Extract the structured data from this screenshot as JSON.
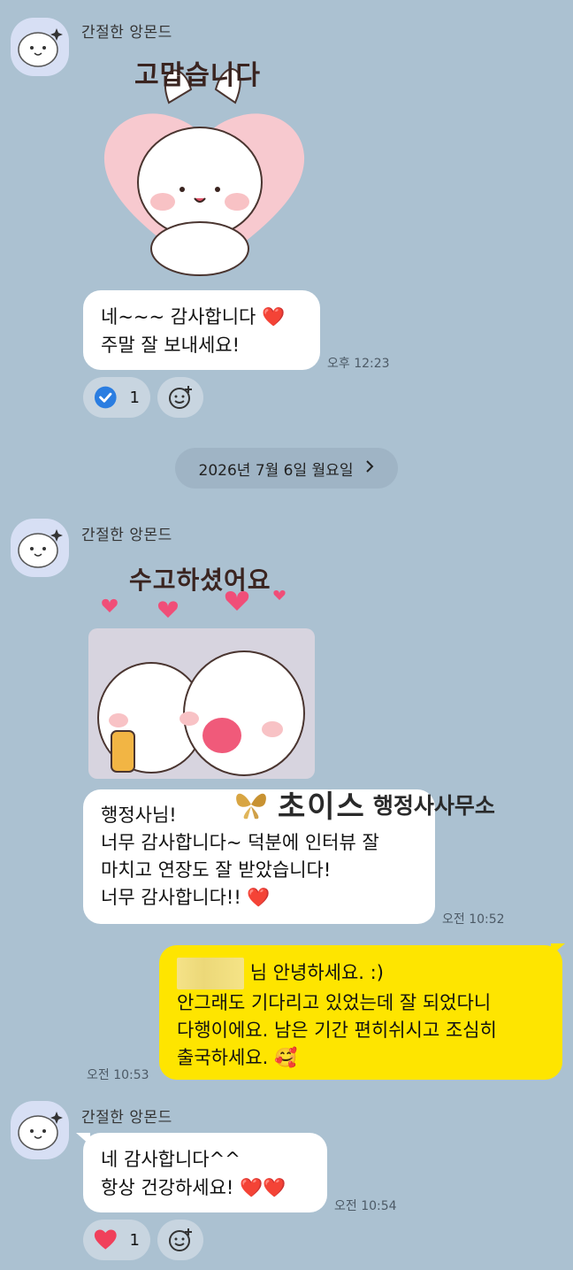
{
  "messages": [
    {
      "sender": "간절한 앙몬드",
      "sticker_text": "고맙습니다",
      "text": "네~~~ 감사합니다 ❤️\n주말 잘 보내세요!",
      "time": "오후 12:23",
      "reaction": {
        "icon": "check-icon",
        "count": "1"
      }
    },
    {
      "date_divider": "2026년 7월 6일 월요일",
      "sender": "간절한 앙몬드",
      "sticker_text": "수고하셨어요",
      "text": "행정사님!\n너무 감사합니다~ 덕분에 인터뷰 잘\n마치고 연장도 잘 받았습니다!\n너무 감사합니다!! ❤️",
      "time": "오전 10:52",
      "watermark": {
        "main": "초이스",
        "sub": "행정사사무소"
      }
    },
    {
      "mine": true,
      "text_first": "님 안녕하세요. :)",
      "text": "안그래도 기다리고 있었는데 잘 되었다니\n다행이에요. 남은 기간 편히쉬시고 조심히\n출국하세요. 🥰",
      "time": "오전 10:53"
    },
    {
      "sender": "간절한 앙몬드",
      "text": "네 감사합니다^^\n항상 건강하세요! ❤️❤️",
      "time": "오전 10:54",
      "reaction": {
        "icon": "heart-icon",
        "count": "1"
      }
    }
  ],
  "colors": {
    "background": "#abc1d1",
    "my_bubble": "#fee500",
    "their_bubble": "#ffffff",
    "check": "#2a7de1",
    "heart": "#f0405b"
  }
}
